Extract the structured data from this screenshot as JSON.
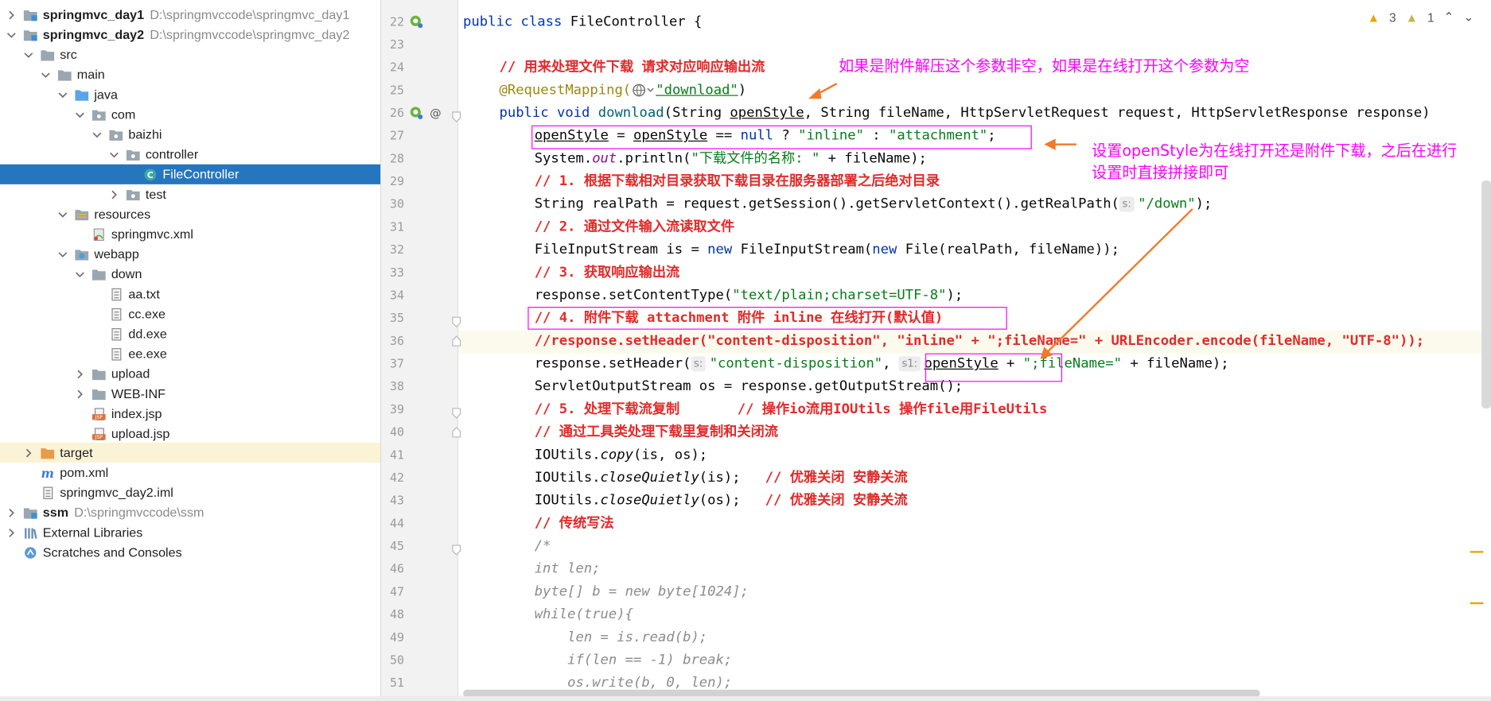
{
  "tree": {
    "items": [
      {
        "label": "springmvc_day1",
        "path": "D:\\springmvccode\\springmvc_day1"
      },
      {
        "label": "springmvc_day2",
        "path": "D:\\springmvccode\\springmvc_day2"
      },
      {
        "label": "src"
      },
      {
        "label": "main"
      },
      {
        "label": "java"
      },
      {
        "label": "com"
      },
      {
        "label": "baizhi"
      },
      {
        "label": "controller"
      },
      {
        "label": "FileController"
      },
      {
        "label": "test"
      },
      {
        "label": "resources"
      },
      {
        "label": "springmvc.xml"
      },
      {
        "label": "webapp"
      },
      {
        "label": "down"
      },
      {
        "label": "aa.txt"
      },
      {
        "label": "cc.exe"
      },
      {
        "label": "dd.exe"
      },
      {
        "label": "ee.exe"
      },
      {
        "label": "upload"
      },
      {
        "label": "WEB-INF"
      },
      {
        "label": "index.jsp"
      },
      {
        "label": "upload.jsp"
      },
      {
        "label": "target"
      },
      {
        "label": "pom.xml"
      },
      {
        "label": "springmvc_day2.iml"
      },
      {
        "label": "ssm",
        "path": "D:\\springmvccode\\ssm"
      },
      {
        "label": "External Libraries"
      },
      {
        "label": "Scratches and Consoles"
      }
    ]
  },
  "editor": {
    "line_numbers": [
      "22",
      "23",
      "24",
      "25",
      "26",
      "27",
      "28",
      "29",
      "30",
      "31",
      "32",
      "33",
      "34",
      "35",
      "36",
      "37",
      "38",
      "39",
      "40",
      "41",
      "42",
      "43",
      "44",
      "45",
      "46",
      "47",
      "48",
      "49",
      "50",
      "51"
    ],
    "status": {
      "warnings": "3",
      "weak_warnings": "1"
    },
    "hint_s": "s:",
    "hint_s1": "s1:",
    "code": {
      "l22_kw": "public class ",
      "l22_rest": "FileController {",
      "l24": "// 用来处理文件下载 请求对应响应输出流",
      "l25_ann": "@RequestMapping(",
      "l25_str": "\"download\"",
      "l25_end": ")",
      "l26_kw": "public void ",
      "l26_name": "download",
      "l26_a": "(String ",
      "l26_u": "openStyle",
      "l26_b": ", String fileName, HttpServletRequest request, HttpServletResponse response)",
      "l27_a": "openStyle",
      "l27_b": " = ",
      "l27_c": "openStyle",
      "l27_d": " == ",
      "l27_null": "null",
      "l27_e": " ? ",
      "l27_s1": "\"inline\"",
      "l27_f": " : ",
      "l27_s2": "\"attachment\"",
      "l27_g": ";",
      "l28_a": "System.",
      "l28_out": "out",
      "l28_b": ".println(",
      "l28_s": "\"下载文件的名称: \"",
      "l28_c": " + fileName);",
      "l29": "// 1. 根据下载相对目录获取下载目录在服务器部署之后绝对目录",
      "l30_a": "String realPath = request.getSession().getServletContext().getRealPath(",
      "l30_s": "\"/down\"",
      "l30_b": ");",
      "l31": "// 2. 通过文件输入流读取文件",
      "l32_a": "FileInputStream is = ",
      "l32_new": "new",
      "l32_b": " FileInputStream(",
      "l32_new2": "new",
      "l32_c": " File(realPath, fileName));",
      "l33": "// 3. 获取响应输出流",
      "l34_a": "response.setContentType(",
      "l34_s": "\"text/plain;charset=UTF-8\"",
      "l34_b": ");",
      "l35": "// 4. 附件下载 attachment 附件 inline 在线打开(默认值)",
      "l36": "//response.setHeader(\"content-disposition\", \"inline\" + \";fileName=\" + URLEncoder.encode(fileName, \"UTF-8\"));",
      "l37_a": "response.setHeader(",
      "l37_s1": "\"content-disposition\"",
      "l37_b": ", ",
      "l37_u": "openStyle",
      "l37_c": " + ",
      "l37_s2": "\";fileName=\"",
      "l37_d": " + fileName);",
      "l38": "ServletOutputStream os = response.getOutputStream();",
      "l39": "// 5. 处理下载流复制       // 操作io流用IOUtils 操作file用FileUtils",
      "l40": "// 通过工具类处理下载里复制和关闭流",
      "l41_a": "IOUtils.",
      "l41_m": "copy",
      "l41_b": "(is, os);",
      "l42_a": "IOUtils.",
      "l42_m": "closeQuietly",
      "l42_b": "(is);   ",
      "l42_c": "// 优雅关闭 安静关流",
      "l43_a": "IOUtils.",
      "l43_m": "closeQuietly",
      "l43_b": "(os);   ",
      "l43_c": "// 优雅关闭 安静关流",
      "l44": "// 传统写法",
      "l45": "/*",
      "l46": "int len;",
      "l47": "byte[] b = new byte[1024];",
      "l48": "while(true){",
      "l49": "    len = is.read(b);",
      "l50": "    if(len == -1) break;",
      "l51": "    os.write(b, 0, len);"
    }
  },
  "notes": {
    "n1": "如果是附件解压这个参数非空，如果是在线打开这个参数为空",
    "n2_l1": "设置openStyle为在线打开还是附件下载，之后在进行",
    "n2_l2": "设置时直接拼接即可"
  },
  "colors": {
    "accent": "#ff00ff",
    "selection": "#2675bf",
    "arrow": "#f07a2b"
  }
}
